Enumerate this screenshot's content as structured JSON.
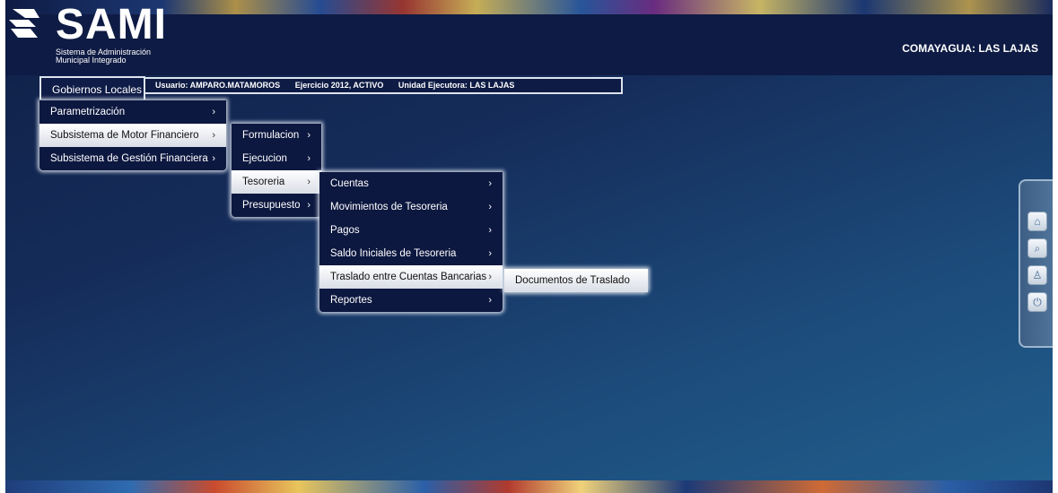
{
  "app": {
    "name": "SAMI",
    "subtitle_line1": "Sistema de Administración",
    "subtitle_line2": "Municipal Integrado",
    "region": "COMAYAGUA: LAS LAJAS"
  },
  "status": {
    "user": "Usuario: AMPARO.MATAMOROS",
    "exercise": "Ejercicio 2012, ACTIVO",
    "unit": "Unidad Ejecutora: LAS LAJAS"
  },
  "menu": {
    "top": "Gobiernos Locales",
    "level1": [
      {
        "label": "Parametrización",
        "chevron": "›"
      },
      {
        "label": "Subsistema de Motor Financiero",
        "chevron": "›"
      },
      {
        "label": "Subsistema de Gestión Financiera",
        "chevron": "›"
      }
    ],
    "level2": [
      {
        "label": "Formulacion",
        "chevron": "›"
      },
      {
        "label": "Ejecucion",
        "chevron": "›"
      },
      {
        "label": "Tesoreria",
        "chevron": "›"
      },
      {
        "label": "Presupuesto",
        "chevron": "›"
      }
    ],
    "level3": [
      {
        "label": "Cuentas",
        "chevron": "›"
      },
      {
        "label": "Movimientos de Tesoreria",
        "chevron": "›"
      },
      {
        "label": "Pagos",
        "chevron": "›"
      },
      {
        "label": "Saldo Iniciales de Tesoreria",
        "chevron": "›"
      },
      {
        "label": "Traslado entre Cuentas Bancarias",
        "chevron": "›"
      },
      {
        "label": "Reportes",
        "chevron": "›"
      }
    ],
    "level4": [
      {
        "label": "Documentos de Traslado"
      }
    ]
  },
  "tools": [
    {
      "icon": "home-icon",
      "glyph": "⌂"
    },
    {
      "icon": "search-document-icon",
      "glyph": "⌕"
    },
    {
      "icon": "award-icon",
      "glyph": "♙"
    },
    {
      "icon": "power-icon",
      "glyph": "⏻"
    }
  ]
}
